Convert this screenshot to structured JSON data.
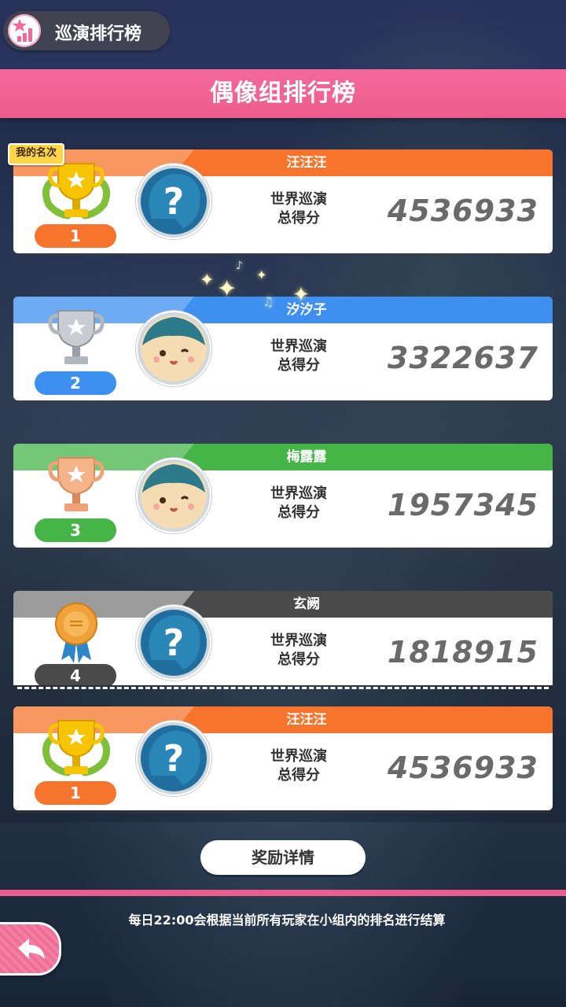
{
  "header": {
    "tab_label": "巡演排行榜",
    "title": "偶像组排行榜"
  },
  "my_rank_badge": "我的名次",
  "score_label_line1": "世界巡演",
  "score_label_line2": "总得分",
  "rankings": [
    {
      "rank": "1",
      "name": "汪汪汪",
      "score": "4536933",
      "color": "#f7742c",
      "trophy": "gold",
      "avatar": "unknown"
    },
    {
      "rank": "2",
      "name": "汐汐子",
      "score": "3322637",
      "color": "#3d8ff0",
      "trophy": "silver",
      "avatar": "cat"
    },
    {
      "rank": "3",
      "name": "梅露露",
      "score": "1957345",
      "color": "#45b548",
      "trophy": "bronze",
      "avatar": "cat"
    },
    {
      "rank": "4",
      "name": "玄阙",
      "score": "1818915",
      "color": "#4a4a4a",
      "trophy": "medal",
      "avatar": "unknown"
    }
  ],
  "my_entry": {
    "rank": "1",
    "name": "汪汪汪",
    "score": "4536933",
    "color": "#f7742c",
    "trophy": "gold",
    "avatar": "unknown"
  },
  "reward_button": "奖励详情",
  "footer_note": "每日22:00会根据当前所有玩家在小组内的排名进行结算"
}
